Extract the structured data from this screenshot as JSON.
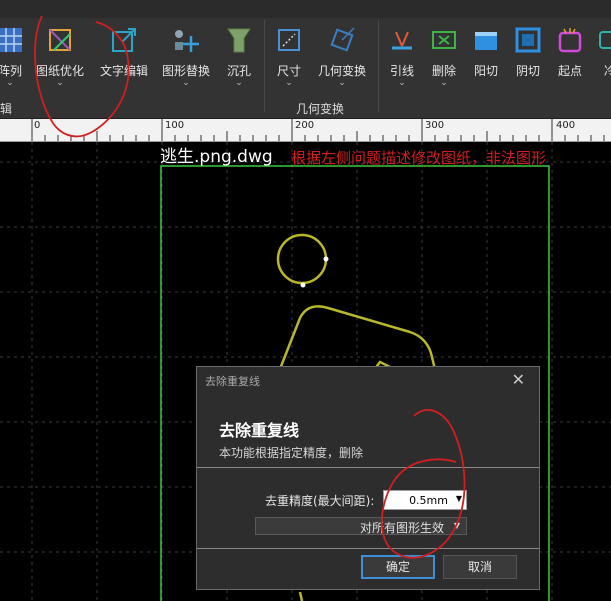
{
  "ribbon": {
    "left_partial_label": "阵列",
    "left_partial_group": "辑",
    "buttons": [
      {
        "label": "图纸优化",
        "icon": "drawing-optimize-icon"
      },
      {
        "label": "文字编辑",
        "icon": "text-edit-icon"
      },
      {
        "label": "图形替换",
        "icon": "shape-replace-icon"
      },
      {
        "label": "沉孔",
        "icon": "countersink-icon"
      },
      {
        "label": "尺寸",
        "icon": "dimension-icon"
      },
      {
        "label": "几何变换",
        "icon": "geometry-transform-icon"
      },
      {
        "label": "引线",
        "icon": "lead-line-icon"
      },
      {
        "label": "删除",
        "icon": "delete-icon"
      },
      {
        "label": "阳切",
        "icon": "positive-cut-icon"
      },
      {
        "label": "阴切",
        "icon": "negative-cut-icon"
      },
      {
        "label": "起点",
        "icon": "start-point-icon"
      },
      {
        "label": "冷",
        "icon": "cooling-icon"
      }
    ],
    "group_label": "几何变换",
    "dropdown_glyph": "⌄"
  },
  "ruler": {
    "ticks": [
      "0",
      "100",
      "200",
      "300",
      "400"
    ]
  },
  "canvas": {
    "file_title": "逃生.png.dwg",
    "warning_text": "根据左侧问题描述修改图纸，非法图形"
  },
  "dialog": {
    "title": "去除重复线",
    "close_glyph": "✕",
    "heading": "去除重复线",
    "description": "本功能根据指定精度，删除",
    "precision_label": "去重精度(最大间距):",
    "precision_value": "0.5mm",
    "scope_value": "对所有图形生效",
    "ok_label": "确定",
    "cancel_label": "取消",
    "arrow_glyph": "▼"
  },
  "colors": {
    "ribbon_bg": "#333333",
    "canvas_bg": "#000000",
    "figure_line": "#b8b82a",
    "frame_line": "#3cc83c",
    "annotation_red": "#d21e1e",
    "dialog_bg": "#2d2d2d",
    "accent_blue": "#3d8fd6"
  }
}
